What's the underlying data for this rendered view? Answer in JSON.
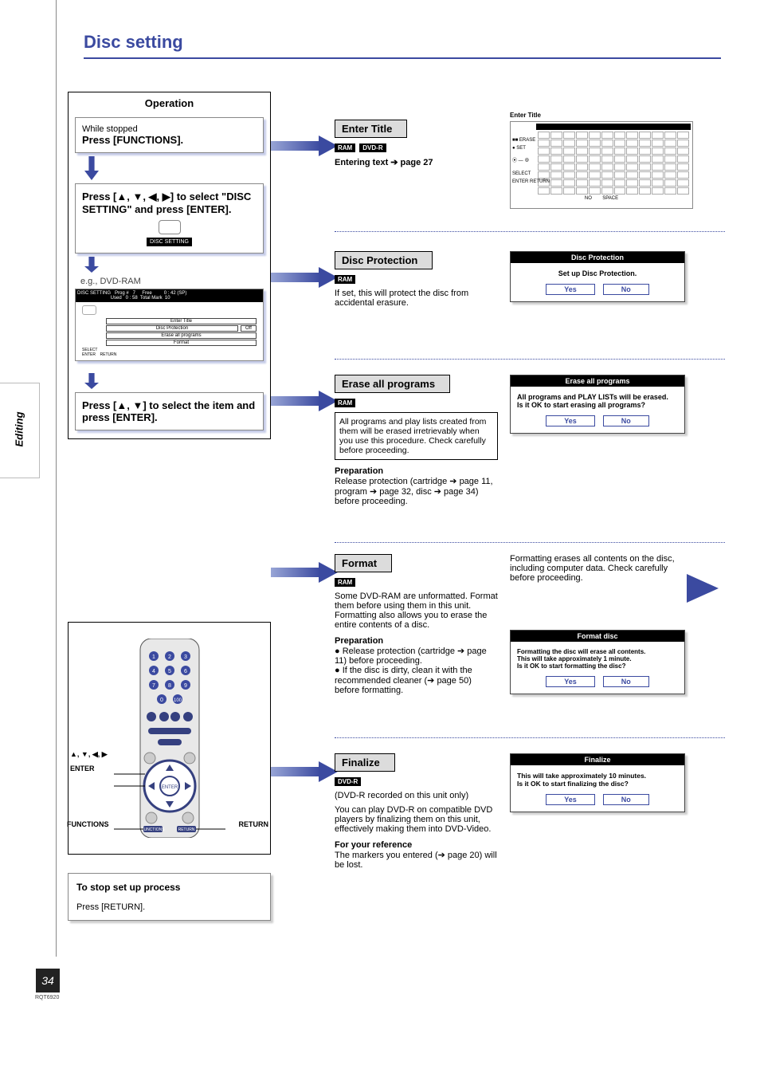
{
  "page": {
    "title": "Disc setting",
    "number": "34",
    "doc_ref": "RQT6920",
    "side_tab": "Editing"
  },
  "operation": {
    "header": "Operation",
    "step1_pre": "While stopped",
    "step1_main": "Press [FUNCTIONS].",
    "step2": "Press [▲, ▼, ◀, ▶] to select \"DISC SETTING\" and press [ENTER].",
    "disc_setting_label": "DISC SETTING",
    "eg": "e.g., DVD-RAM",
    "mini_top": "DISC SETTING   Prog #   7     Free         0 : 42 (SP)\n                         Used   0 : 58  Total Mark  10",
    "mini_items": {
      "r1": "Enter Title",
      "r2a": "Disc Protection",
      "r2b": "Off",
      "r3": "Erase all programs",
      "r4": "Format"
    },
    "mini_ctrl": "SELECT\nENTER    RETURN",
    "step3": "Press [▲, ▼] to select the item and press [ENTER]."
  },
  "remote": {
    "arrows_label": "▲, ▼, ◀, ▶",
    "enter_label": "ENTER",
    "functions_label": "FUNCTIONS",
    "return_label": "RETURN"
  },
  "stop": {
    "heading": "To stop set up process",
    "body": "Press [RETURN]."
  },
  "enter_title": {
    "header": "Enter Title",
    "tags": [
      "RAM",
      "DVD-R"
    ],
    "line": "Entering text ➔ page 27",
    "palette_title": "Enter Title",
    "ctrl1": "■■  ERASE",
    "ctrl2": "●   SET",
    "ctrl3": "⦿ — ⊕",
    "ctrl4": "SELECT",
    "ctrl5": "ENTER      RETURN",
    "space": "SPACE",
    "no_lbl": "NO"
  },
  "protection": {
    "header": "Disc Protection",
    "tags": [
      "RAM"
    ],
    "body": "If set, this will protect the disc from accidental erasure.",
    "dtitle": "Disc Protection",
    "dbody": "Set up Disc Protection.",
    "yes": "Yes",
    "no": "No"
  },
  "erase": {
    "header": "Erase all programs",
    "tags": [
      "RAM"
    ],
    "boxed": "All programs and play lists created from them will be erased irretrievably when you use this procedure. Check carefully before proceeding.",
    "prep_h": "Preparation",
    "prep": "Release protection (cartridge ➔ page 11, program ➔ page 32, disc ➔ page 34) before proceeding.",
    "dtitle": "Erase all programs",
    "dbody": "All programs and PLAY LISTs will be erased.\nIs it OK to start erasing all programs?",
    "yes": "Yes",
    "no": "No"
  },
  "format": {
    "header": "Format",
    "tags": [
      "RAM"
    ],
    "body": "Some DVD-RAM are unformatted. Format them before using them in this unit. Formatting also allows you to erase the entire contents of a disc.",
    "prep_h": "Preparation",
    "prep1": "Release protection (cartridge ➔ page 11) before proceeding.",
    "prep2": "If the disc is dirty, clean it with the recommended cleaner (➔ page 50) before formatting.",
    "warn": "Formatting erases all contents on the disc, including computer data. Check carefully before proceeding.",
    "dtitle": "Format disc",
    "dbody": "Formatting the disc will erase all contents.\nThis will take approximately 1 minute.\nIs it OK to start formatting the disc?",
    "yes": "Yes",
    "no": "No"
  },
  "finalize": {
    "header": "Finalize",
    "tags": [
      "DVD-R"
    ],
    "sub": "(DVD-R recorded on this unit only)",
    "body": "You can play DVD-R on compatible DVD players by finalizing them on this unit, effectively making them into DVD-Video.",
    "ref_h": "For your reference",
    "ref": "The markers you entered (➔ page 20) will be lost.",
    "dtitle": "Finalize",
    "dbody": "This will take approximately 10 minutes.\nIs it OK to start finalizing the disc?",
    "yes": "Yes",
    "no": "No"
  }
}
